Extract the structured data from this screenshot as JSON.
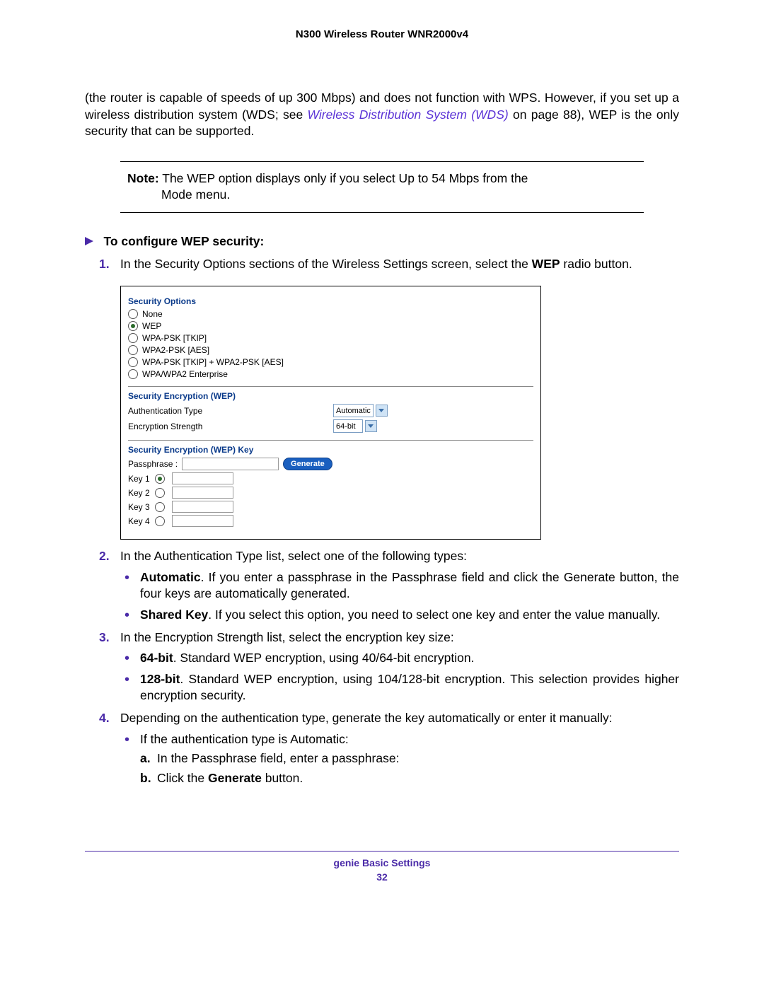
{
  "header": {
    "title": "N300 Wireless Router WNR2000v4"
  },
  "intro": {
    "line1a": "(the router is capable of speeds of up 300 Mbps) and does not function with WPS. However, if you set up a wireless distribution system (WDS; see ",
    "link": "Wireless Distribution System (WDS)",
    "line1b": " on page 88), WEP is the only security that can be supported."
  },
  "note": {
    "label": "Note:",
    "text": " The WEP option displays only if you select Up to 54 Mbps from the",
    "cont": "Mode menu."
  },
  "procedure": {
    "title": "To configure WEP security:",
    "step1a": "In the Security Options sections of the Wireless Settings screen, select the ",
    "step1b": "WEP",
    "step1c": " radio button.",
    "step2": "In the Authentication Type list, select one of the following types:",
    "step2_b1a": "Automatic",
    "step2_b1b": ". If you enter a passphrase in the Passphrase field and click the Generate button, the four keys are automatically generated.",
    "step2_b2a": "Shared Key",
    "step2_b2b": ". If you select this option, you need to select one key and enter the value manually.",
    "step3": "In the Encryption Strength list, select the encryption key size:",
    "step3_b1a": "64-bit",
    "step3_b1b": ". Standard WEP encryption, using 40/64-bit encryption.",
    "step3_b2a": "128-bit",
    "step3_b2b": ". Standard WEP encryption, using 104/128-bit encryption. This selection provides higher encryption security.",
    "step4": "Depending on the authentication type, generate the key automatically or enter it manually:",
    "step4_b1": "If the authentication type is Automatic:",
    "step4_b1_a": "In the Passphrase field, enter a passphrase:",
    "step4_b1_b_pre": "Click the ",
    "step4_b1_b_bold": "Generate",
    "step4_b1_b_post": " button."
  },
  "ui": {
    "sec_options_title": "Security Options",
    "opts": {
      "none": "None",
      "wep": "WEP",
      "wpa_tkip": "WPA-PSK [TKIP]",
      "wpa2_aes": "WPA2-PSK [AES]",
      "wpa_mix": "WPA-PSK [TKIP] + WPA2-PSK [AES]",
      "enterprise": "WPA/WPA2 Enterprise"
    },
    "enc_title": "Security Encryption (WEP)",
    "auth_label": "Authentication Type",
    "auth_value": "Automatic",
    "strength_label": "Encryption Strength",
    "strength_value": "64-bit",
    "key_title": "Security Encryption (WEP) Key",
    "passphrase_label": "Passphrase :",
    "generate": "Generate",
    "key1": "Key 1",
    "key2": "Key 2",
    "key3": "Key 3",
    "key4": "Key 4"
  },
  "footer": {
    "section": "genie Basic Settings",
    "page": "32"
  }
}
